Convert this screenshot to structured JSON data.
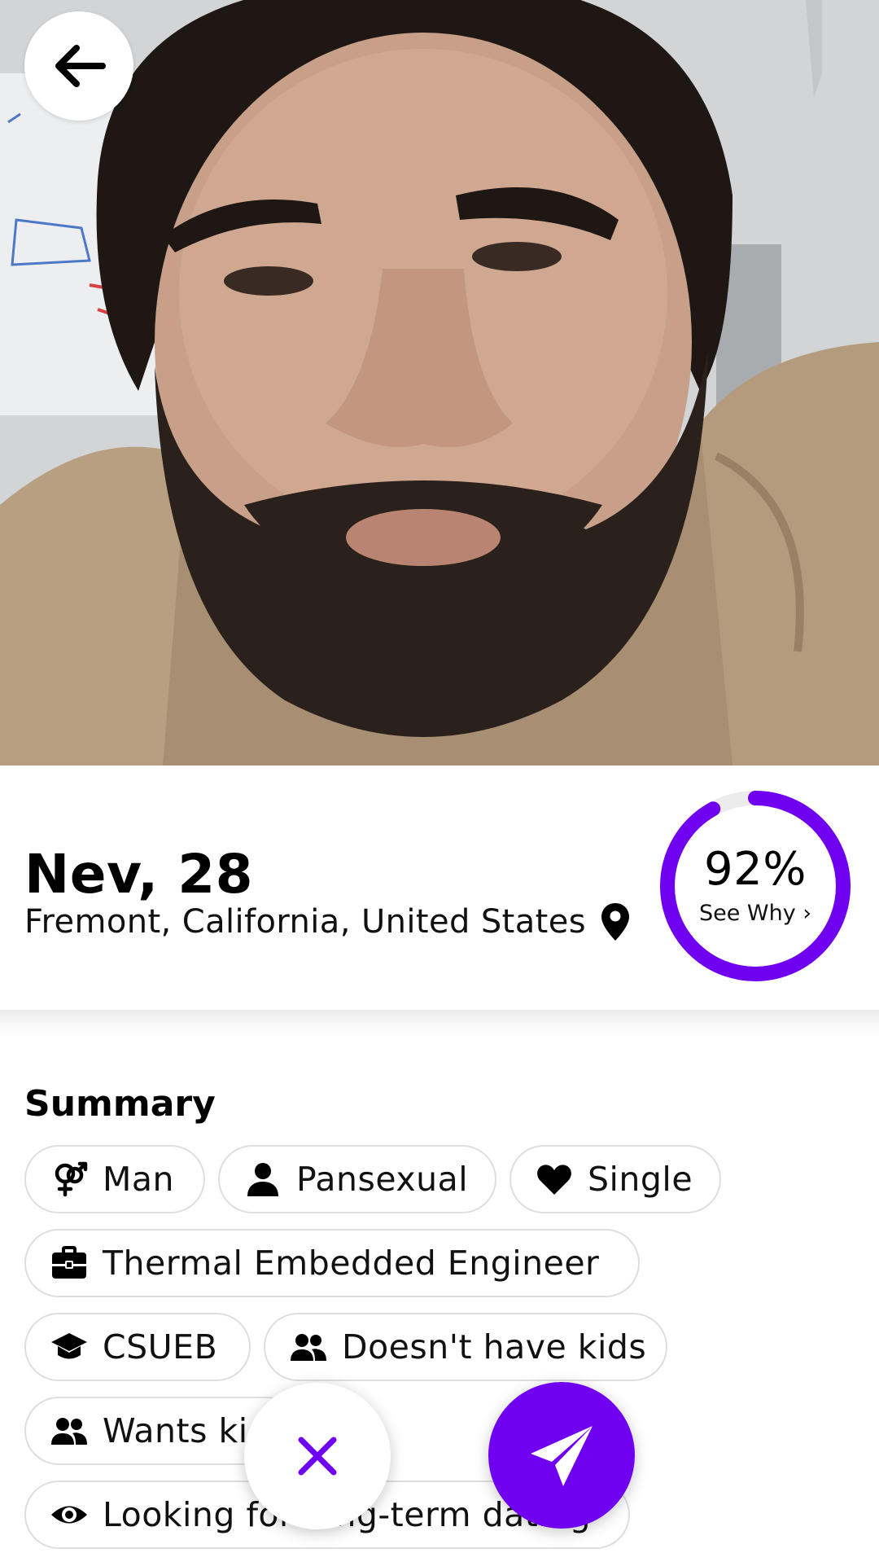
{
  "profile": {
    "name_age": "Nev, 28",
    "location": "Fremont, California, United States"
  },
  "match": {
    "percent_label": "92%",
    "percent_value": 92,
    "see_why_label": "See Why ›"
  },
  "summary": {
    "title": "Summary",
    "chips": [
      {
        "label": "Man",
        "icon": "gender-icon"
      },
      {
        "label": "Pansexual",
        "icon": "person-icon"
      },
      {
        "label": "Single",
        "icon": "heart-icon"
      },
      {
        "label": "Thermal Embedded Engineer",
        "icon": "briefcase-icon"
      },
      {
        "label": "CSUEB",
        "icon": "graduation-cap-icon"
      },
      {
        "label": "Doesn't have kids",
        "icon": "people-icon"
      },
      {
        "label": "Wants kids",
        "icon": "people-icon"
      },
      {
        "label": "Looking for long-term dating",
        "icon": "eye-icon"
      }
    ]
  },
  "colors": {
    "accent": "#7000f0",
    "chip_border": "#dedede",
    "ring_track": "#ececec"
  }
}
